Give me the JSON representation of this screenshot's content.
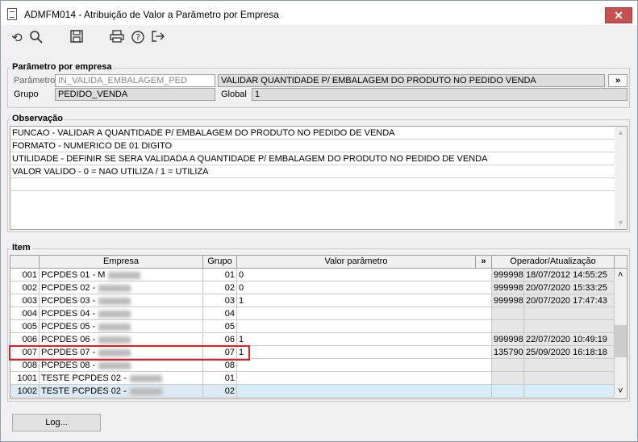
{
  "window": {
    "title": "ADMFM014 - Atribuição de Valor a Parâmetro por Empresa",
    "close": "✕"
  },
  "toolbar": [
    "undo-icon",
    "search-icon",
    "save-icon",
    "print-icon",
    "help-icon",
    "exit-icon"
  ],
  "param_group": {
    "title": "Parâmetro por empresa",
    "param_label": "Parâmetro",
    "param_value": "IN_VALIDA_EMBALAGEM_PED",
    "param_desc": "VALIDAR QUANTIDADE P/ EMBALAGEM DO PRODUTO NO PEDIDO VENDA",
    "expand": "»",
    "grupo_label": "Grupo",
    "grupo_value": "PEDIDO_VENDA",
    "global_label": "Global",
    "global_value": "1"
  },
  "obs_group": {
    "title": "Observação",
    "lines": [
      "FUNCAO - VALIDAR A QUANTIDADE P/ EMBALAGEM DO PRODUTO NO PEDIDO DE VENDA",
      "FORMATO - NUMERICO DE 01 DIGITO",
      "UTILIDADE - DEFINIR SE SERA VALIDADA A QUANTIDADE P/ EMBALAGEM DO PRODUTO NO PEDIDO DE VENDA",
      "VALOR VALIDO - 0 = NAO UTILIZA / 1 = UTILIZA",
      ""
    ]
  },
  "item_group": {
    "title": "Item",
    "columns": {
      "empresa": "Empresa",
      "grupo": "Grupo",
      "valor": "Valor parâmetro",
      "expand": "»",
      "operador": "Operador/Atualização"
    },
    "rows": [
      {
        "code": "001",
        "empresa": "PCPDES 01 - M",
        "grupo": "01",
        "valor": "0",
        "op": "999998",
        "data": "18/07/2012 14:55:25"
      },
      {
        "code": "002",
        "empresa": "PCPDES 02 -",
        "grupo": "02",
        "valor": "0",
        "op": "999998",
        "data": "20/07/2020 15:33:25"
      },
      {
        "code": "003",
        "empresa": "PCPDES 03 -",
        "grupo": "03",
        "valor": "1",
        "op": "999998",
        "data": "20/07/2020 17:47:43"
      },
      {
        "code": "004",
        "empresa": "PCPDES 04 -",
        "grupo": "04",
        "valor": "",
        "op": "",
        "data": ""
      },
      {
        "code": "005",
        "empresa": "PCPDES 05 -",
        "grupo": "05",
        "valor": "",
        "op": "",
        "data": ""
      },
      {
        "code": "006",
        "empresa": "PCPDES 06 -",
        "grupo": "06",
        "valor": "1",
        "op": "999998",
        "data": "22/07/2020 10:49:19"
      },
      {
        "code": "007",
        "empresa": "PCPDES 07 -",
        "grupo": "07",
        "valor": "1",
        "op": "135790",
        "data": "25/09/2020 16:18:18"
      },
      {
        "code": "008",
        "empresa": "PCPDES 08 -",
        "grupo": "08",
        "valor": "",
        "op": "",
        "data": ""
      },
      {
        "code": "1001",
        "empresa": "TESTE PCPDES 02 -",
        "grupo": "01",
        "valor": "",
        "op": "",
        "data": ""
      },
      {
        "code": "1002",
        "empresa": "TESTE PCPDES 02 -",
        "grupo": "02",
        "valor": "",
        "op": "",
        "data": ""
      }
    ]
  },
  "log_button": "Log...",
  "colors": {
    "highlight": "#e02020",
    "selected_row": "#d7eef9",
    "close": "#c75050"
  }
}
